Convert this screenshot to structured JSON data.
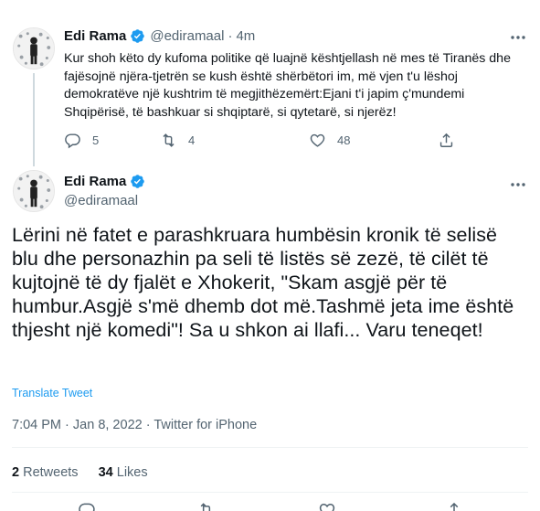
{
  "parent_tweet": {
    "author_name": "Edi Rama",
    "handle": "@ediramaal",
    "separator": "·",
    "time_ago": "4m",
    "text": "Kur shoh këto dy kufoma politike që luajnë kështjellash në mes të Tiranës dhe fajësojnë njëra-tjetrën se kush është shërbëtori im, më vjen t'u lëshoj demokratëve një kushtrim të megjithëzemërt:Ejani t'i japim ç'mundemi Shqipërisë, të bashkuar si shqiptarë, si qytetarë, si njerëz!",
    "replies": "5",
    "retweets": "4",
    "likes": "48"
  },
  "main_tweet": {
    "author_name": "Edi Rama",
    "handle": "@ediramaal",
    "text": "Lërini në fatet e parashkruara humbësin kronik të selisë blu dhe personazhin pa seli të listës së zezë, të cilët të kujtojnë të dy fjalët e Xhokerit, \"Skam asgjë për të humbur.Asgjë s'më dhemb dot më.Tashmë jeta ime është thjesht një komedi\"! Sa u shkon ai llafi... Varu teneqet!",
    "translate_label": "Translate Tweet",
    "time": "7:04 PM",
    "separator": "·",
    "date": "Jan 8, 2022",
    "source": "Twitter for iPhone",
    "retweet_count": "2",
    "retweet_label": "Retweets",
    "like_count": "34",
    "like_label": "Likes"
  },
  "colors": {
    "accent": "#1d9bf0",
    "muted_text": "#536471",
    "primary_text": "#0f1419",
    "divider": "#eff3f4"
  },
  "icons": {
    "verified": "verified-badge-icon",
    "more": "more-horizontal-icon",
    "reply": "reply-icon",
    "retweet": "retweet-icon",
    "like": "heart-icon",
    "share": "share-icon"
  }
}
